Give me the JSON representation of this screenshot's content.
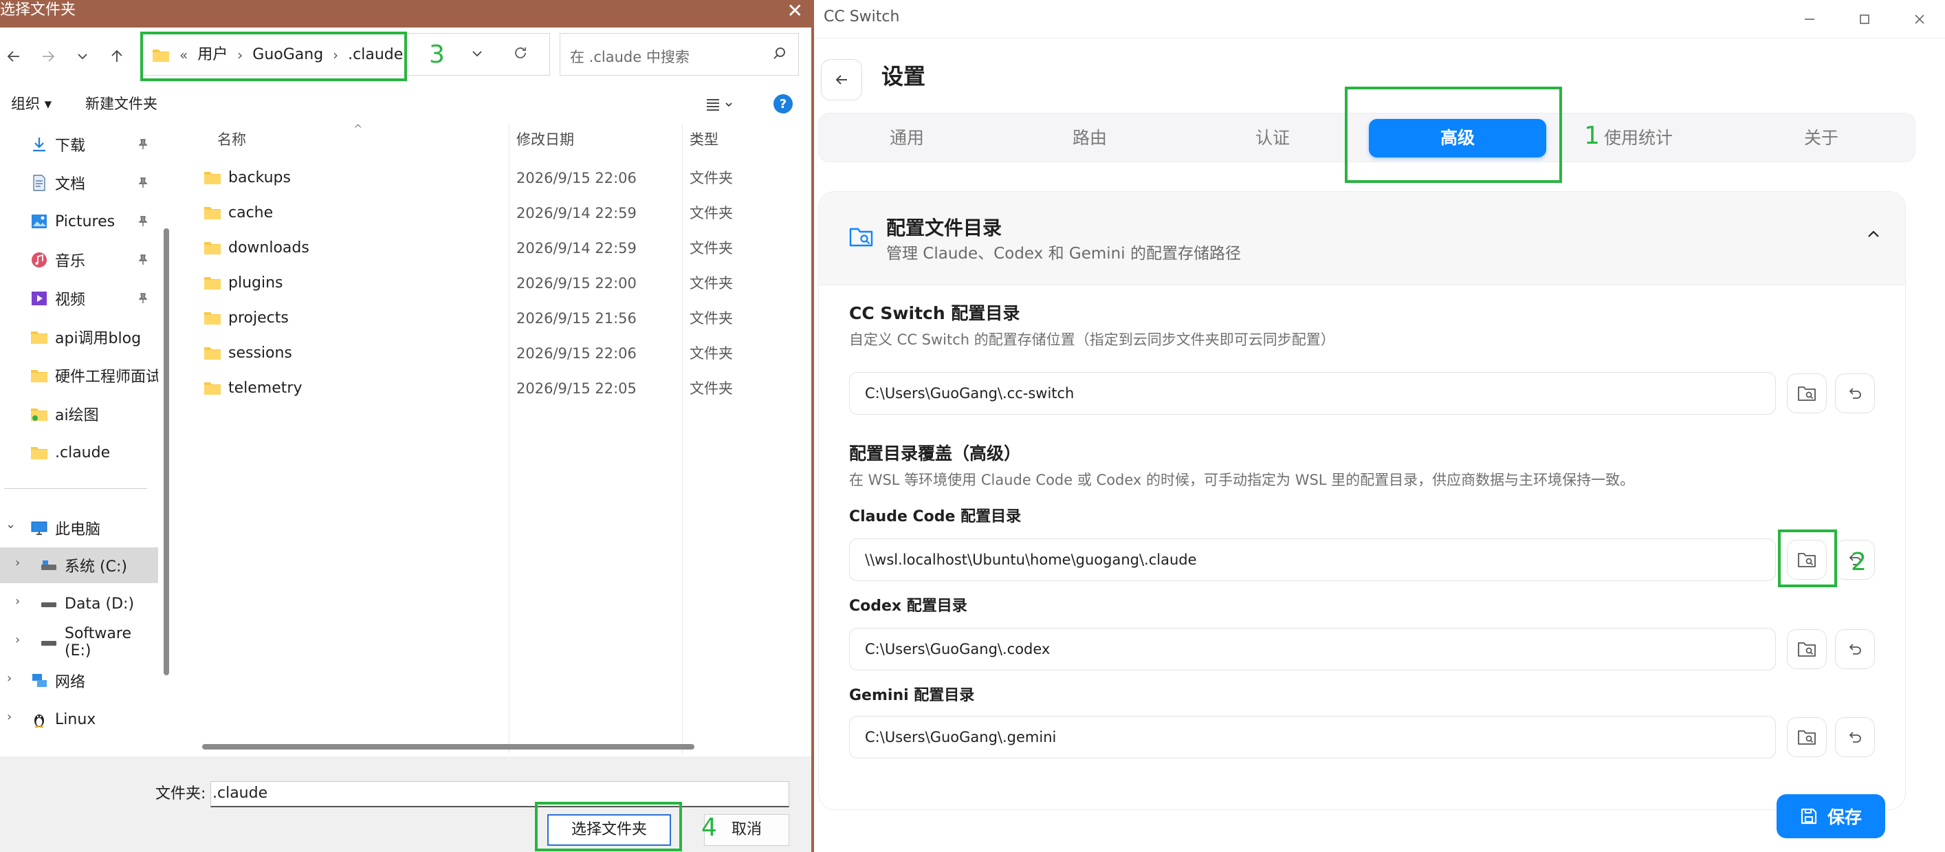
{
  "dialog": {
    "title": "选择文件夹",
    "breadcrumb": [
      "«",
      "用户",
      "GuoGang",
      ".claude"
    ],
    "search_placeholder": "在 .claude 中搜索",
    "cmd_organize": "组织",
    "cmd_new_folder": "新建文件夹",
    "nav_items": [
      {
        "label": "下载",
        "icon": "download-icon"
      },
      {
        "label": "文档",
        "icon": "document-icon"
      },
      {
        "label": "Pictures",
        "icon": "pictures-icon"
      },
      {
        "label": "音乐",
        "icon": "music-icon"
      },
      {
        "label": "视频",
        "icon": "video-icon"
      },
      {
        "label": "api调用blog",
        "icon": "folder-icon"
      },
      {
        "label": "硬件工程师面试",
        "icon": "folder-icon"
      },
      {
        "label": "ai绘图",
        "icon": "folder-icon"
      },
      {
        "label": ".claude",
        "icon": "folder-icon"
      }
    ],
    "tree_items": [
      {
        "label": "此电脑",
        "icon": "computer-icon"
      },
      {
        "label": "系统 (C:)",
        "icon": "drive-icon"
      },
      {
        "label": "Data (D:)",
        "icon": "drive-icon"
      },
      {
        "label": "Software (E:)",
        "icon": "drive-icon"
      },
      {
        "label": "网络",
        "icon": "network-icon"
      },
      {
        "label": "Linux",
        "icon": "linux-icon"
      }
    ],
    "columns": {
      "name": "名称",
      "date": "修改日期",
      "type": "类型"
    },
    "files": [
      {
        "name": "backups",
        "date": "2026/9/15 22:06",
        "type": "文件夹"
      },
      {
        "name": "cache",
        "date": "2026/9/14 22:59",
        "type": "文件夹"
      },
      {
        "name": "downloads",
        "date": "2026/9/14 22:59",
        "type": "文件夹"
      },
      {
        "name": "plugins",
        "date": "2026/9/15 22:00",
        "type": "文件夹"
      },
      {
        "name": "projects",
        "date": "2026/9/15 21:56",
        "type": "文件夹"
      },
      {
        "name": "sessions",
        "date": "2026/9/15 22:06",
        "type": "文件夹"
      },
      {
        "name": "telemetry",
        "date": "2026/9/15 22:05",
        "type": "文件夹"
      }
    ],
    "folder_label": "文件夹:",
    "folder_value": ".claude",
    "select_button": "选择文件夹",
    "cancel_button": "取消"
  },
  "cc": {
    "window_title": "CC Switch",
    "page_title": "设置",
    "tabs": [
      "通用",
      "路由",
      "认证",
      "高级",
      "使用统计",
      "关于"
    ],
    "active_tab": "高级",
    "card_title": "配置文件目录",
    "card_desc": "管理 Claude、Codex 和 Gemini 的配置存储路径",
    "cc_dir_title": "CC Switch 配置目录",
    "cc_dir_desc": "自定义 CC Switch 的配置存储位置（指定到云同步文件夹即可云同步配置）",
    "cc_dir_value": "C:\\Users\\GuoGang\\.cc-switch",
    "override_title": "配置目录覆盖（高级）",
    "override_desc": "在 WSL 等环境使用 Claude Code 或 Codex 的时候，可手动指定为 WSL 里的配置目录，供应商数据与主环境保持一致。",
    "claude_label": "Claude Code 配置目录",
    "claude_value": "\\\\wsl.localhost\\Ubuntu\\home\\guogang\\.claude",
    "codex_label": "Codex 配置目录",
    "codex_value": "C:\\Users\\GuoGang\\.codex",
    "gemini_label": "Gemini 配置目录",
    "gemini_value": "C:\\Users\\GuoGang\\.gemini",
    "save_button": "保存"
  },
  "annotations": [
    "1",
    "2",
    "3",
    "4"
  ],
  "colors": {
    "accent": "#0a84ff",
    "annotation": "#27b53f",
    "dialog_titlebar": "#a0614a"
  }
}
